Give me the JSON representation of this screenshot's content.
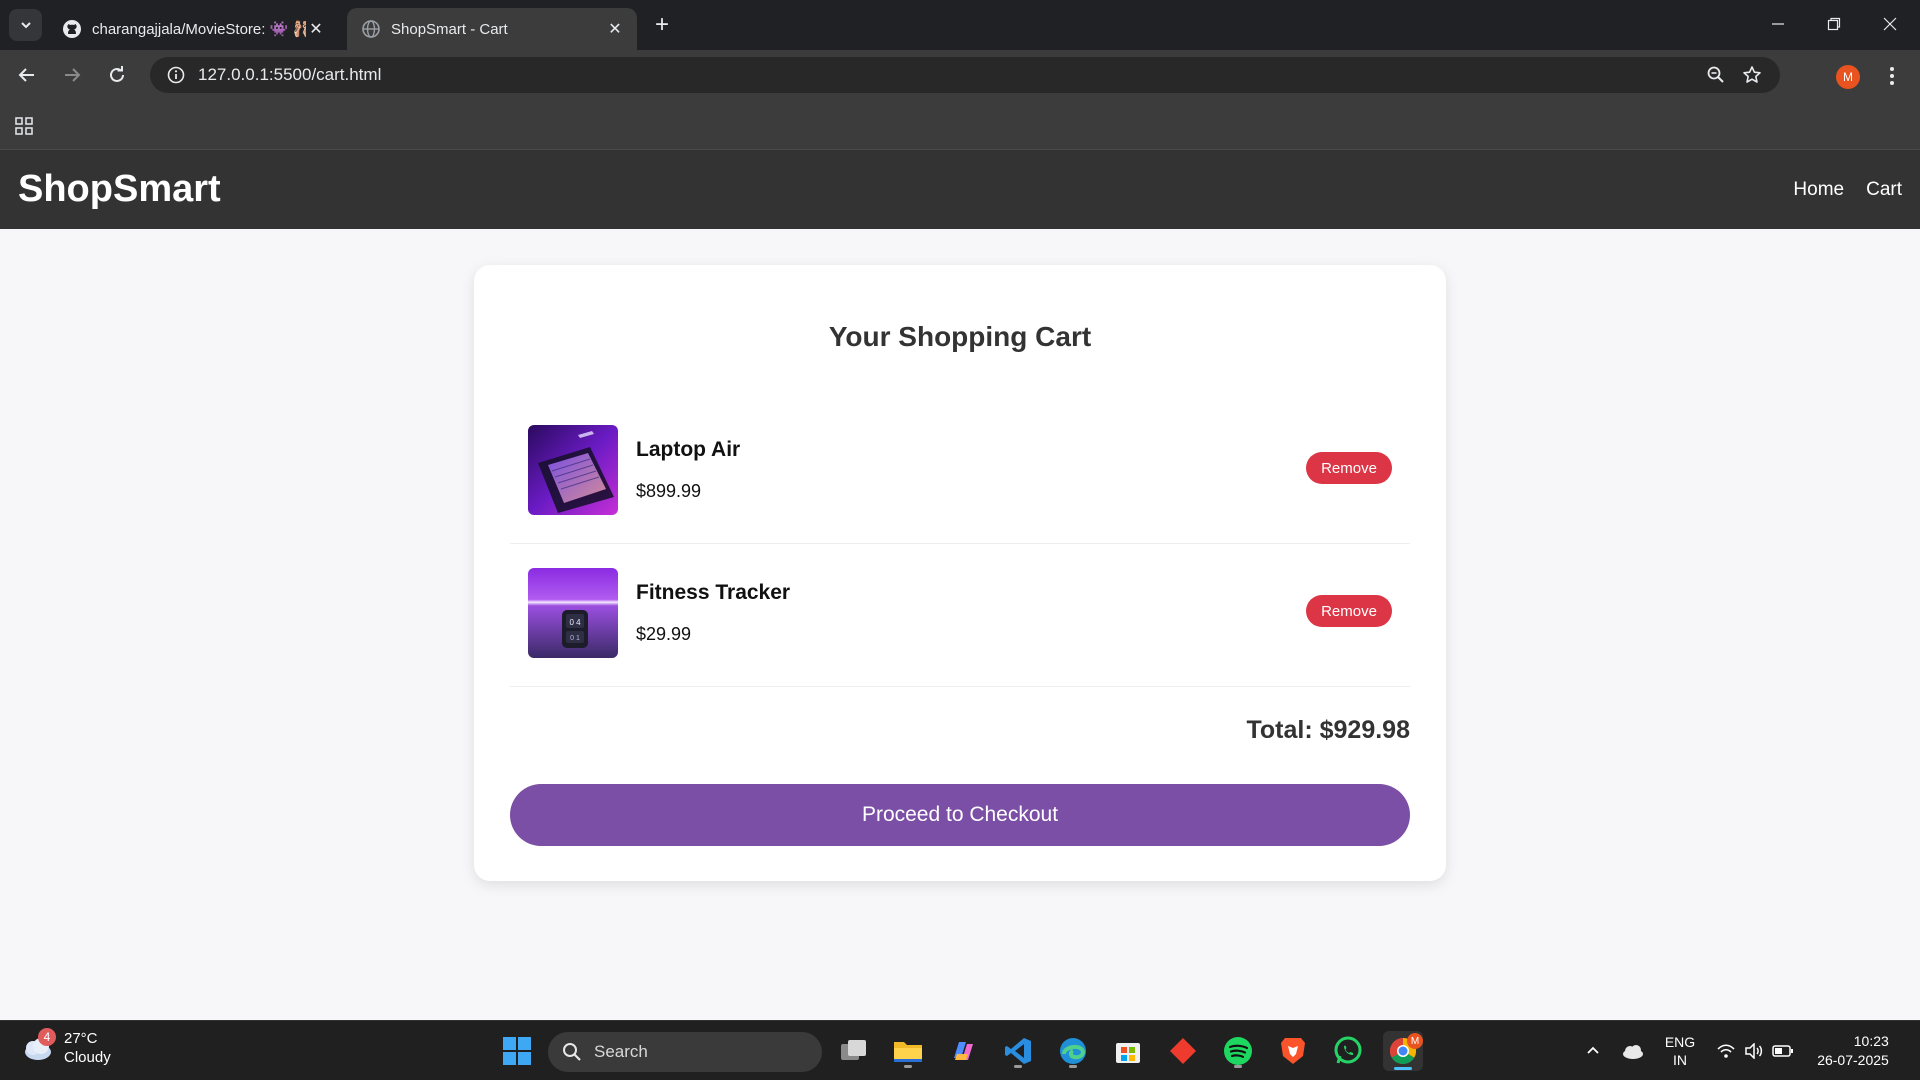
{
  "browser": {
    "tabs": [
      {
        "title": "charangajjala/MovieStore: 👾 🩰",
        "active": false
      },
      {
        "title": "ShopSmart - Cart",
        "active": true
      }
    ],
    "url": "127.0.0.1:5500/cart.html",
    "profile_initial": "M"
  },
  "site": {
    "brand": "ShopSmart",
    "nav": [
      {
        "label": "Home"
      },
      {
        "label": "Cart"
      }
    ]
  },
  "cart": {
    "heading": "Your Shopping Cart",
    "items": [
      {
        "name": "Laptop Air",
        "price": "$899.99",
        "remove_label": "Remove"
      },
      {
        "name": "Fitness Tracker",
        "price": "$29.99",
        "remove_label": "Remove"
      }
    ],
    "total": "Total: $929.98",
    "checkout_label": "Proceed to Checkout"
  },
  "taskbar": {
    "weather": {
      "temp": "27°C",
      "condition": "Cloudy",
      "badge": "4"
    },
    "search_placeholder": "Search",
    "lang": {
      "line1": "ENG",
      "line2": "IN"
    },
    "time": "10:23",
    "date": "26-07-2025",
    "chrome_badge": "M"
  },
  "colors": {
    "header_bg": "#333333",
    "remove_button": "#dc3545",
    "checkout_button": "#7b4fa5",
    "page_bg": "#f7f7f9"
  }
}
